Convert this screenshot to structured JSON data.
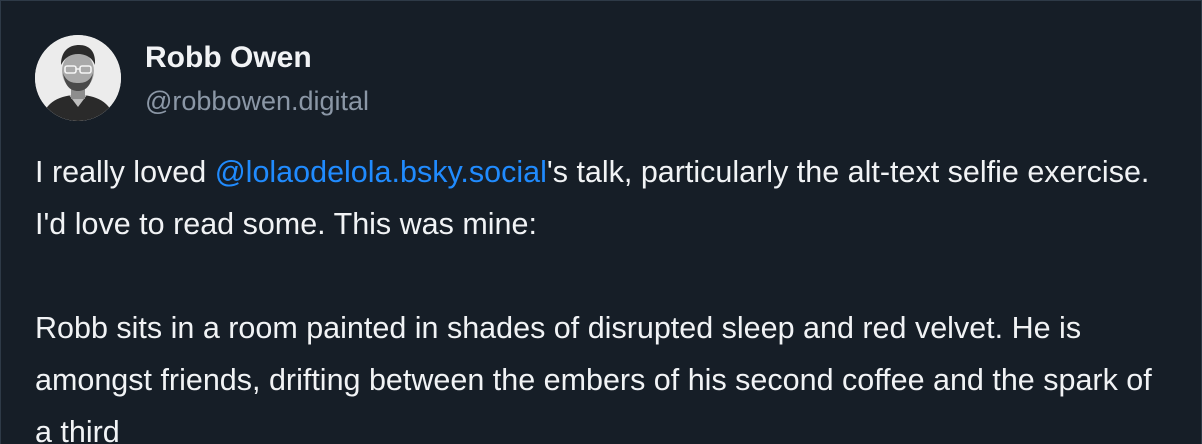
{
  "author": {
    "display_name": "Robb Owen",
    "handle": "@robbowen.digital"
  },
  "post": {
    "p1_before": "I really loved ",
    "mention": "@lolaodelola.bsky.social",
    "p1_after": "'s talk, particularly the alt-text selfie exercise. I'd love to read some. This was mine:",
    "p2": "Robb sits in a room painted in shades of disrupted sleep and red velvet. He is amongst friends, drifting between the embers of his second coffee and the spark of a third"
  },
  "colors": {
    "background": "#161e27",
    "text": "#f1f3f5",
    "secondary_text": "#8b97a6",
    "link": "#208bfe"
  }
}
